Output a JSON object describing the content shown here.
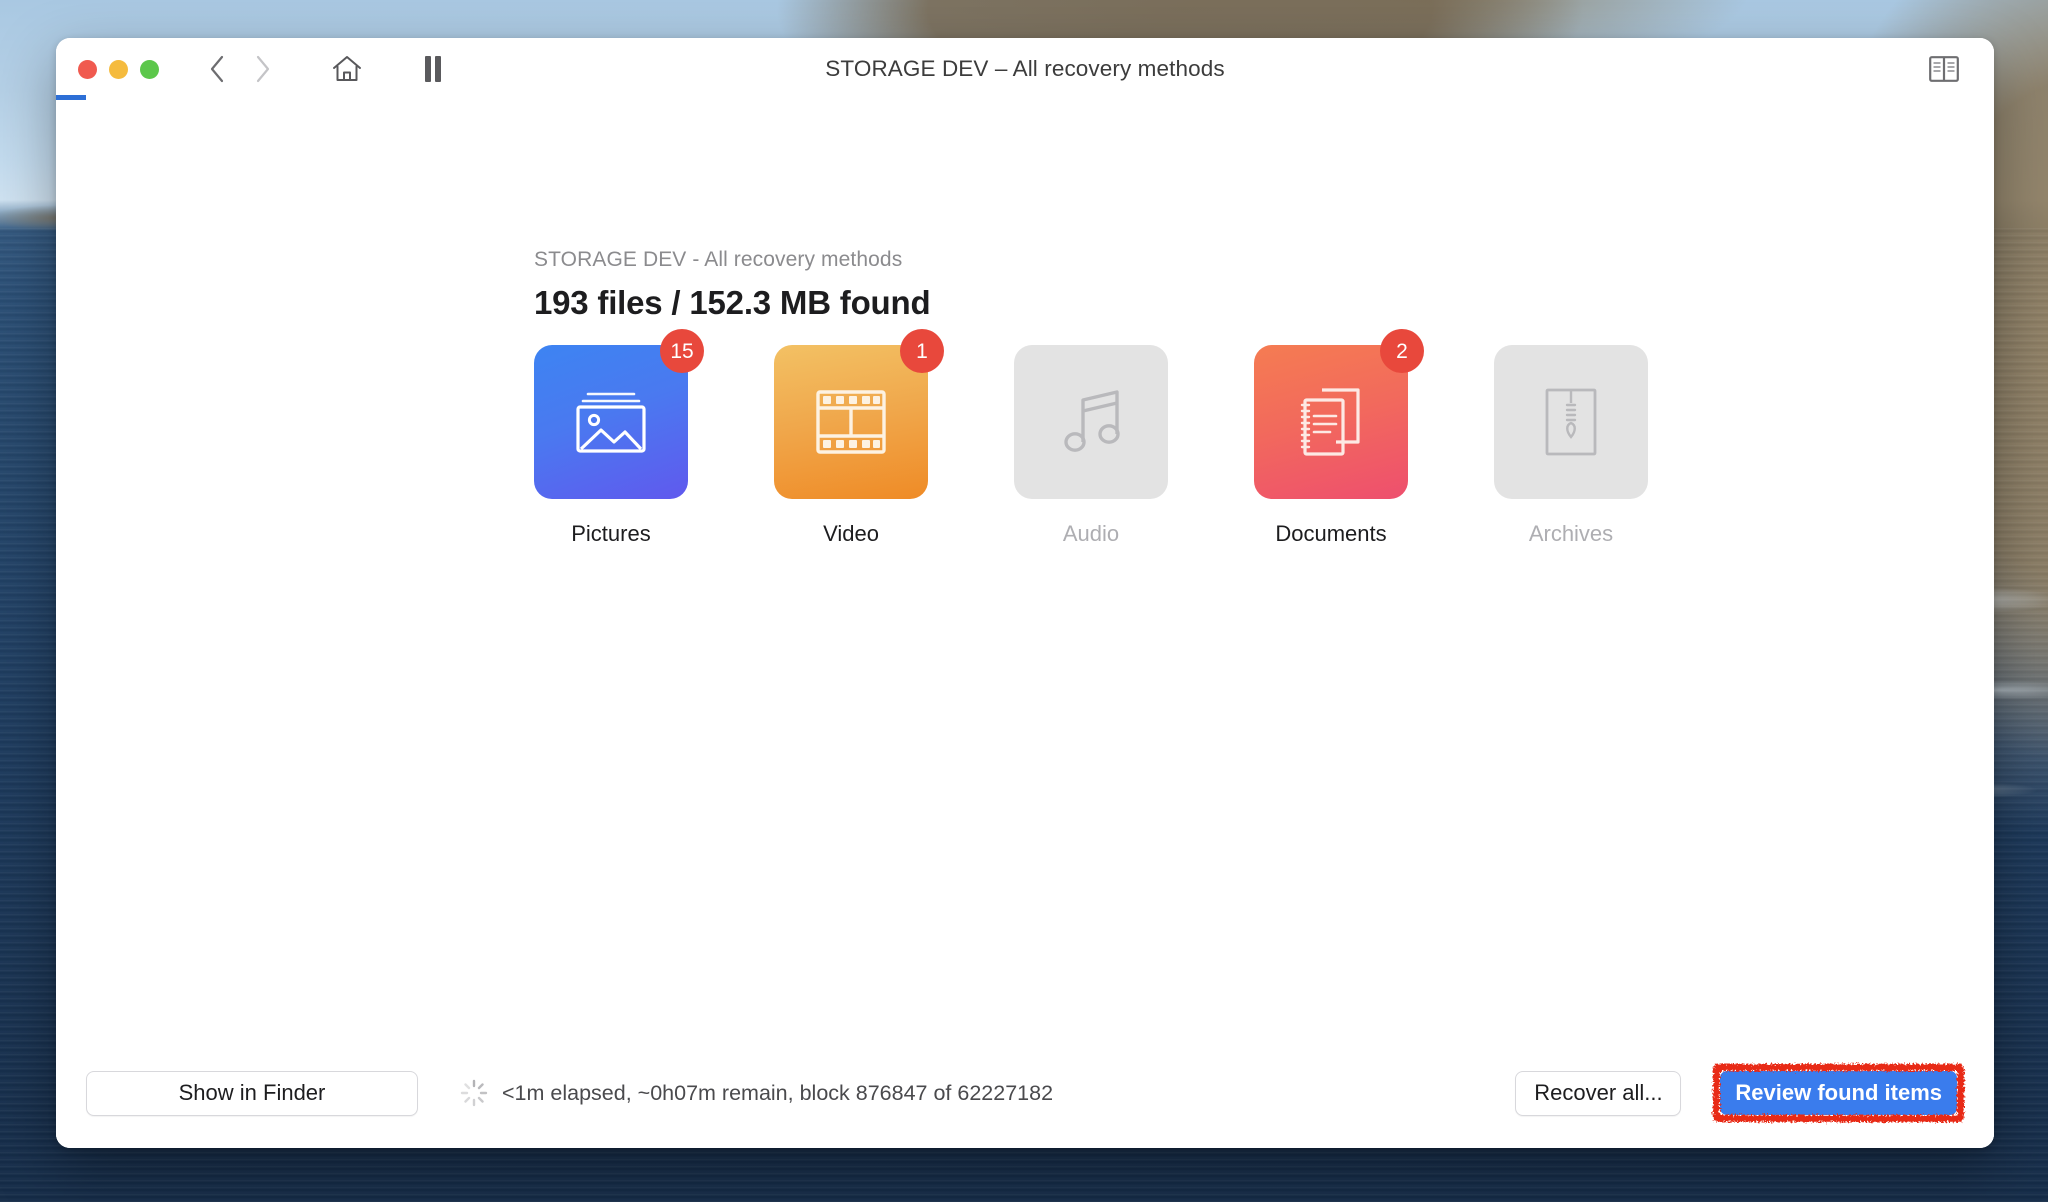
{
  "window": {
    "title": "STORAGE DEV – All recovery methods",
    "traffic_lights": [
      "close",
      "minimize",
      "maximize"
    ],
    "progress_bar_color": "#2d6fd6"
  },
  "toolbar": {
    "back_icon": "chevron-left-icon",
    "forward_icon": "chevron-right-icon",
    "home_icon": "home-icon",
    "pause_icon": "pause-icon",
    "manual_icon": "book-icon"
  },
  "header": {
    "subtitle": "STORAGE DEV - All recovery methods",
    "title": "193 files / 152.3 MB found"
  },
  "categories": [
    {
      "label": "Pictures",
      "badge": "15",
      "icon": "image-icon",
      "enabled": true,
      "color_start": "#3d84f2",
      "color_end": "#6059ee"
    },
    {
      "label": "Video",
      "badge": "1",
      "icon": "filmstrip-icon",
      "enabled": true,
      "color_start": "#f3c164",
      "color_end": "#ef8b26"
    },
    {
      "label": "Audio",
      "badge": "",
      "icon": "music-note-icon",
      "enabled": false,
      "color_start": "#e3e3e3",
      "color_end": "#e3e3e3"
    },
    {
      "label": "Documents",
      "badge": "2",
      "icon": "documents-icon",
      "enabled": true,
      "color_start": "#f57c52",
      "color_end": "#ee4f6e"
    },
    {
      "label": "Archives",
      "badge": "",
      "icon": "zip-icon",
      "enabled": false,
      "color_start": "#e3e3e3",
      "color_end": "#e3e3e3"
    }
  ],
  "bottom_bar": {
    "show_in_finder_label": "Show in Finder",
    "spinner_icon": "spinner-icon",
    "status_text": "<1m elapsed, ~0h07m remain, block 876847 of 62227182",
    "recover_all_label": "Recover all...",
    "review_found_items_label": "Review found items",
    "review_button_color": "#3a7ced",
    "annotation_color": "#e82c19"
  }
}
